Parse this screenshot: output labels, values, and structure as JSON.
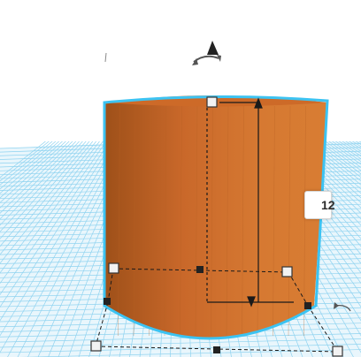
{
  "workplane": {
    "grid_color": "#8fd3f0",
    "background": "#ffffff"
  },
  "shape": {
    "kind": "cylinder",
    "fill_color": "#d2712e",
    "top_color": "#cd6a28",
    "selection_outline_color": "#3cc3f2"
  },
  "dimension": {
    "height_value": "12",
    "label": "height"
  },
  "icons": {
    "rotate": "rotate-arrow-icon",
    "lift": "lift-cone-icon",
    "rotate_side": "rotate-side-icon",
    "handle": "resize-handle-icon"
  }
}
